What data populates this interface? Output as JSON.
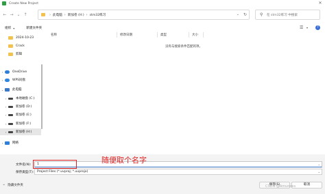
{
  "window": {
    "title": "Create New Project"
  },
  "address": {
    "crumbs": [
      "此电脑",
      "新加卷 (H:)",
      "stm32练习"
    ]
  },
  "search": {
    "placeholder": "在 stm32练习 中搜索"
  },
  "toolbar": {
    "organize": "组织",
    "new_folder": "新建文件夹"
  },
  "sidebar": {
    "items": [
      {
        "label": "2024-10-23",
        "icon": "folder-icon",
        "indent": 1,
        "chevron": ""
      },
      {
        "label": "Crack",
        "icon": "folder-icon",
        "indent": 1,
        "chevron": ""
      },
      {
        "label": "剪辑",
        "icon": "folder-icon",
        "indent": 1,
        "chevron": ""
      },
      {
        "label": "OneDrive",
        "icon": "cloud-icon",
        "indent": 0,
        "chevron": "›"
      },
      {
        "label": "WPS同盘",
        "icon": "wps-icon",
        "indent": 0,
        "chevron": "›"
      },
      {
        "label": "此电脑",
        "icon": "pc-icon",
        "indent": 0,
        "chevron": "⌄"
      },
      {
        "label": "本地磁盘 (C:)",
        "icon": "drive-icon",
        "indent": 1,
        "chevron": "›"
      },
      {
        "label": "新加卷 (D:)",
        "icon": "drive-icon",
        "indent": 1,
        "chevron": "›"
      },
      {
        "label": "新加卷 (E:)",
        "icon": "drive-icon",
        "indent": 1,
        "chevron": "›"
      },
      {
        "label": "新加卷 (F:)",
        "icon": "drive-icon",
        "indent": 1,
        "chevron": "›"
      },
      {
        "label": "新加卷 (H:)",
        "icon": "drive-icon",
        "indent": 1,
        "chevron": "›",
        "selected": true
      },
      {
        "label": "网络",
        "icon": "network-icon",
        "indent": 0,
        "chevron": "›"
      }
    ]
  },
  "columns": [
    "名称",
    "修改日期",
    "类型",
    "大小"
  ],
  "content": {
    "empty_message": "没有与搜索条件匹配的项。"
  },
  "footer": {
    "filename_label": "文件名(N):",
    "filename_value": "1",
    "filetype_label": "保存类型(T):",
    "filetype_value": "Project Files (*.uvproj; *.uvprojx)",
    "hide_folders": "隐藏文件夹",
    "save": "保存(S)",
    "cancel": "取消"
  },
  "annotation": {
    "text": "随便取个名字"
  },
  "watermark": "CSDN @Amunoes"
}
